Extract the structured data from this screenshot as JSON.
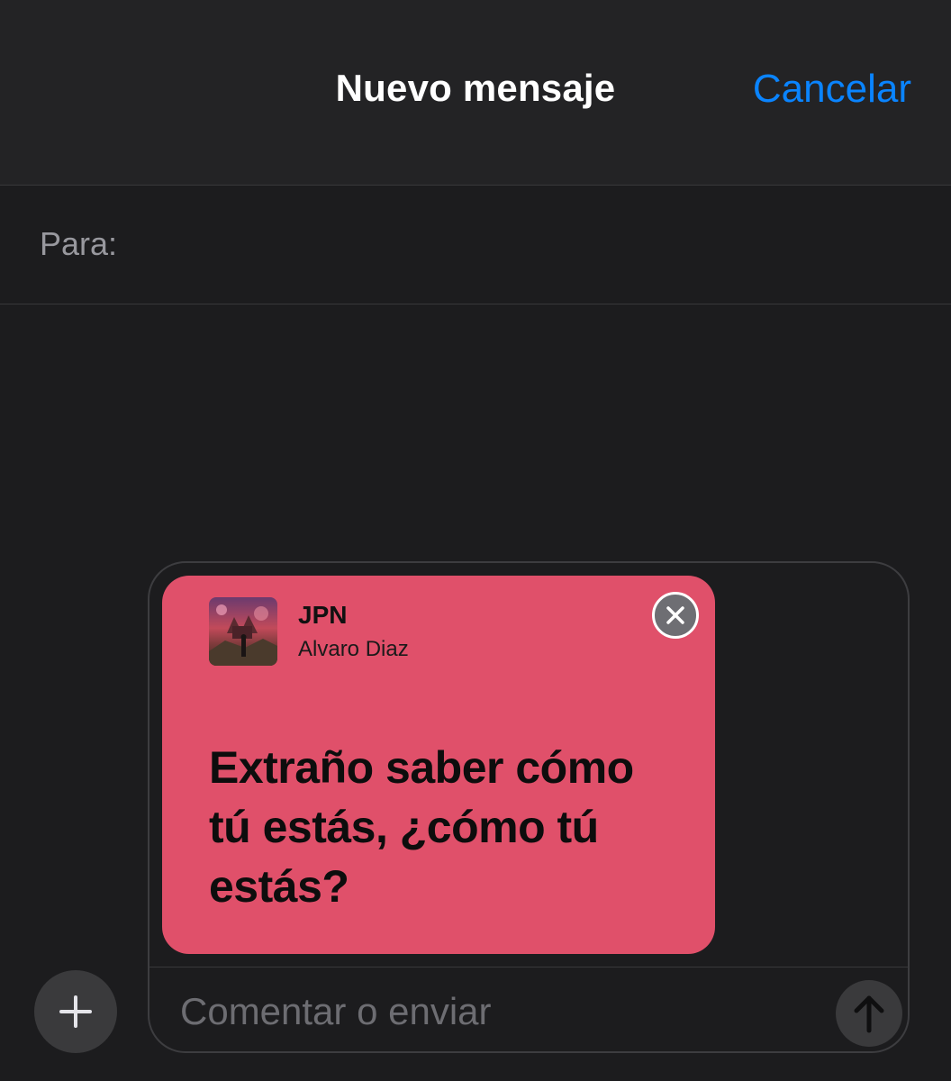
{
  "header": {
    "title": "Nuevo mensaje",
    "cancel_label": "Cancelar"
  },
  "recipient": {
    "label": "Para:",
    "value": ""
  },
  "share_card": {
    "track_title": "JPN",
    "artist": "Alvaro Diaz",
    "lyric": "Extraño saber cómo tú estás, ¿cómo tú estás?",
    "background_color": "#e0506a"
  },
  "composer": {
    "placeholder": "Comentar o enviar",
    "value": ""
  },
  "icons": {
    "add": "plus-icon",
    "send": "arrow-up-icon",
    "remove": "close-icon"
  },
  "colors": {
    "accent": "#0a84ff",
    "background": "#1c1c1e",
    "card": "#e0506a"
  }
}
